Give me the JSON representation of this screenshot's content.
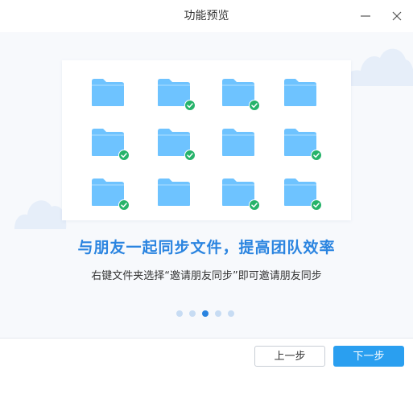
{
  "window": {
    "title": "功能预览",
    "minimize_icon": "minimize-icon",
    "close_icon": "close-icon"
  },
  "slide": {
    "folders": [
      {
        "checked": false
      },
      {
        "checked": true
      },
      {
        "checked": true
      },
      {
        "checked": false
      },
      {
        "checked": true
      },
      {
        "checked": true
      },
      {
        "checked": false
      },
      {
        "checked": true
      },
      {
        "checked": true
      },
      {
        "checked": false
      },
      {
        "checked": true
      },
      {
        "checked": true
      }
    ],
    "headline": "与朋友一起同步文件，提高团队效率",
    "description": "右键文件夹选择“邀请朋友同步”即可邀请朋友同步"
  },
  "pagination": {
    "total": 5,
    "current": 3
  },
  "footer": {
    "prev_label": "上一步",
    "next_label": "下一步"
  },
  "colors": {
    "accent": "#2a84e0",
    "folder": "#6ec3ff",
    "check": "#26b36a",
    "next_button": "#2a9ff0"
  }
}
